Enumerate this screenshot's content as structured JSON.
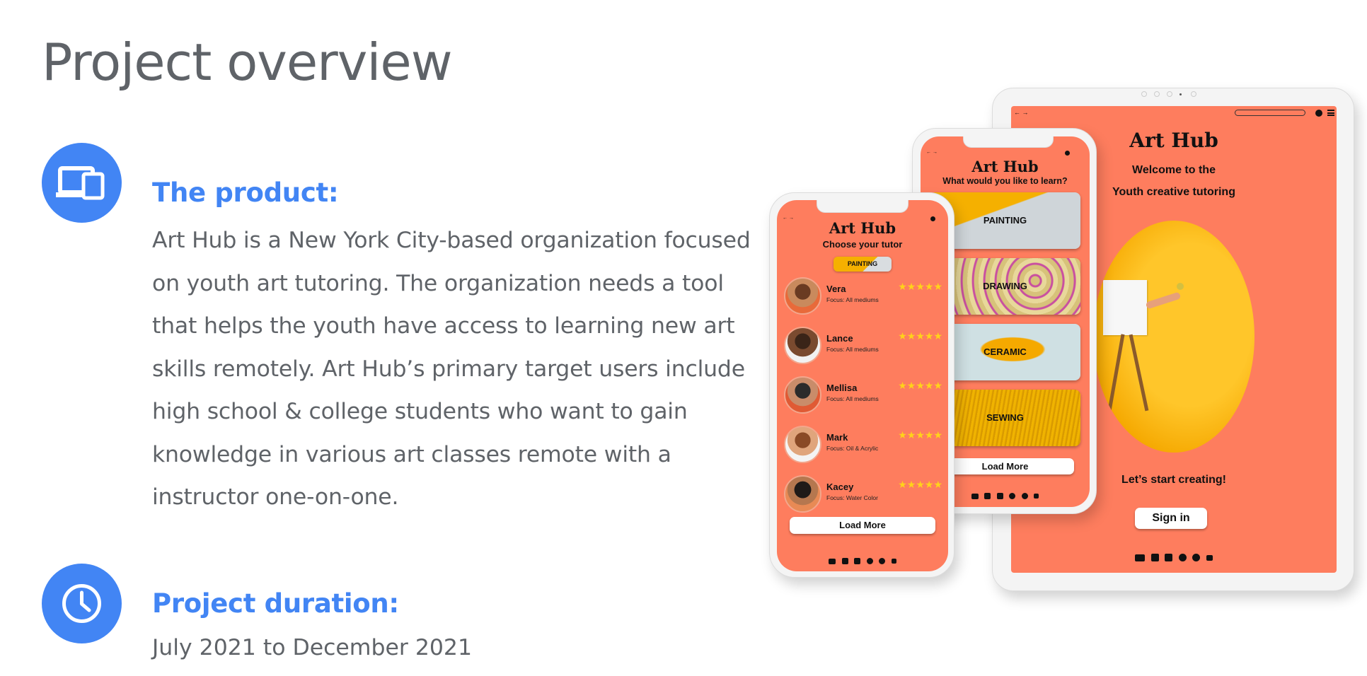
{
  "slide": {
    "title": "Project overview",
    "product": {
      "heading": "The product:",
      "body": "Art Hub is a New York City-based organization focused on youth art tutoring. The organization needs a tool that helps the youth have access to learning new art skills remotely. Art Hub’s  primary target users include high school & college students who want to gain knowledge in various art classes remote with a instructor one-on-one.",
      "icon": "devices-icon"
    },
    "duration": {
      "heading": "Project duration:",
      "body": "July 2021 to December 2021",
      "icon": "clock-icon"
    }
  },
  "colors": {
    "accent": "#4285f4",
    "text": "#5f6368",
    "coral": "#fe7d5e",
    "star": "#ffd21a"
  },
  "mockups": {
    "brand": "Art Hub",
    "phone": {
      "subtitle": "Choose your tutor",
      "filter_chip": "PAINTING",
      "tutors": [
        {
          "name": "Vera",
          "focus": "Focus: All mediums",
          "rating": 5
        },
        {
          "name": "Lance",
          "focus": "Focus: All mediums",
          "rating": 5
        },
        {
          "name": "Mellisa",
          "focus": "Focus: All mediums",
          "rating": 5
        },
        {
          "name": "Mark",
          "focus": "Focus: Oil & Acrylic",
          "rating": 5
        },
        {
          "name": "Kacey",
          "focus": "Focus: Water Color",
          "rating": 5
        }
      ],
      "stars": "★★★★★",
      "load_more": "Load More"
    },
    "small_tablet": {
      "subtitle": "What would you like to learn?",
      "categories": [
        "PAINTING",
        "DRAWING",
        "CERAMIC",
        "SEWING"
      ],
      "load_more": "Load More"
    },
    "tablet": {
      "welcome_line1": "Welcome to the",
      "welcome_line2": "Youth creative tutoring",
      "cta_text": "Let’s start creating!",
      "sign_in": "Sign in"
    },
    "nav_arrows": "← →"
  }
}
